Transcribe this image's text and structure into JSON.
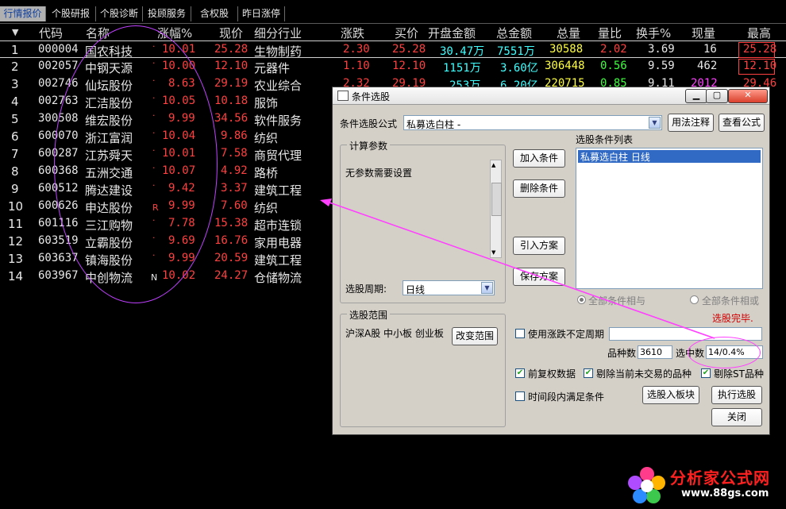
{
  "tabs": [
    "行情报价",
    "个股研报",
    "个股诊断",
    "投顾服务",
    "含权股",
    "昨日涨停"
  ],
  "columns": {
    "sort_icon": "▼",
    "code": "代码",
    "name": "名称",
    "change_pct": "涨幅%",
    "price": "现价",
    "industry": "细分行业",
    "change": "涨跌",
    "bid": "买价",
    "open_amount": "开盘金额",
    "total_amount": "总金额",
    "volume": "总量",
    "vol_ratio": "量比",
    "turnover": "换手%",
    "current_vol": "现量",
    "high": "最高"
  },
  "rows": [
    {
      "idx": "1",
      "code": "000004",
      "name": "国农科技",
      "flag": "·",
      "change_pct": "10.01",
      "price": "25.28",
      "industry": "生物制药",
      "change": "2.30",
      "bid": "25.28",
      "open_amount": "30.47万",
      "total_amount": "7551万",
      "volume": "30588",
      "vol_ratio": "2.02",
      "turnover": "3.69",
      "current_vol": "16",
      "high": "25.28"
    },
    {
      "idx": "2",
      "code": "002057",
      "name": "中钢天源",
      "flag": "·",
      "change_pct": "10.00",
      "price": "12.10",
      "industry": "元器件",
      "change": "1.10",
      "bid": "12.10",
      "open_amount": "1151万",
      "total_amount": "3.60亿",
      "volume": "306448",
      "vol_ratio": "0.56",
      "turnover": "9.59",
      "current_vol": "462",
      "high": "12.10"
    },
    {
      "idx": "3",
      "code": "002746",
      "name": "仙坛股份",
      "flag": "·",
      "change_pct": "8.63",
      "price": "29.19",
      "industry": "农业综合",
      "change": "2.32",
      "bid": "29.19",
      "open_amount": "253万",
      "total_amount": "6.20亿",
      "volume": "220715",
      "vol_ratio": "0.85",
      "turnover": "9.11",
      "current_vol": "2012",
      "high": "29.46"
    },
    {
      "idx": "4",
      "code": "002763",
      "name": "汇洁股份",
      "flag": "·",
      "change_pct": "10.05",
      "price": "10.18",
      "industry": "服饰"
    },
    {
      "idx": "5",
      "code": "300508",
      "name": "维宏股份",
      "flag": "·",
      "change_pct": "9.99",
      "price": "34.56",
      "industry": "软件服务"
    },
    {
      "idx": "6",
      "code": "600070",
      "name": "浙江富润",
      "flag": "·",
      "change_pct": "10.04",
      "price": "9.86",
      "industry": "纺织"
    },
    {
      "idx": "7",
      "code": "600287",
      "name": "江苏舜天",
      "flag": "·",
      "change_pct": "10.01",
      "price": "7.58",
      "industry": "商贸代理"
    },
    {
      "idx": "8",
      "code": "600368",
      "name": "五洲交通",
      "flag": "·",
      "change_pct": "10.07",
      "price": "4.92",
      "industry": "路桥"
    },
    {
      "idx": "9",
      "code": "600512",
      "name": "腾达建设",
      "flag": "·",
      "change_pct": "9.42",
      "price": "3.37",
      "industry": "建筑工程"
    },
    {
      "idx": "10",
      "code": "600626",
      "name": "申达股份",
      "flag": "R",
      "change_pct": "9.99",
      "price": "7.60",
      "industry": "纺织"
    },
    {
      "idx": "11",
      "code": "601116",
      "name": "三江购物",
      "flag": "·",
      "change_pct": "7.78",
      "price": "15.38",
      "industry": "超市连锁"
    },
    {
      "idx": "12",
      "code": "603519",
      "name": "立霸股份",
      "flag": "·",
      "change_pct": "9.69",
      "price": "16.76",
      "industry": "家用电器"
    },
    {
      "idx": "13",
      "code": "603637",
      "name": "镇海股份",
      "flag": "·",
      "change_pct": "9.99",
      "price": "20.59",
      "industry": "建筑工程"
    },
    {
      "idx": "14",
      "code": "603967",
      "name": "中创物流",
      "flag": "N",
      "change_pct": "10.02",
      "price": "24.27",
      "industry": "仓储物流"
    }
  ],
  "dialog": {
    "title": "条件选股",
    "win_minimize": "▁",
    "win_restore": "▢",
    "win_close": "✕",
    "formula_label": "条件选股公式",
    "formula_value": "私募选白柱  -",
    "usage_btn": "用法注释",
    "view_btn": "查看公式",
    "params_group": "计算参数",
    "params_text": "无参数需要设置",
    "period_label": "选股周期:",
    "period_value": "日线",
    "add_btn": "加入条件",
    "delete_btn": "删除条件",
    "import_btn": "引入方案",
    "save_btn": "保存方案",
    "list_title": "选股条件列表",
    "list_item": "私募选白柱  日线",
    "radio_and": "全部条件相与",
    "radio_or": "全部条件相或",
    "done_text": "选股完毕.",
    "range_group": "选股范围",
    "range_text": "沪深A股 中小板 创业板",
    "change_range_btn": "改变范围",
    "uncertain_period": "使用涨跌不定周期",
    "count_label": "品种数",
    "count_value": "3610",
    "selected_label": "选中数",
    "selected_value": "14/0.4%",
    "chk_rights": "前复权数据",
    "chk_no_trade": "剔除当前未交易的品种",
    "chk_st": "剔除ST品种",
    "chk_time": "时间段内满足条件",
    "to_block_btn": "选股入板块",
    "execute_btn": "执行选股",
    "close_btn": "关闭"
  },
  "logo": {
    "main": "分析家公式网",
    "url": "www.88gs.com"
  },
  "colors": {
    "up": "#ff4040",
    "accent": "#ff40ff",
    "annotation": "#c040ff",
    "background": "#000000"
  }
}
